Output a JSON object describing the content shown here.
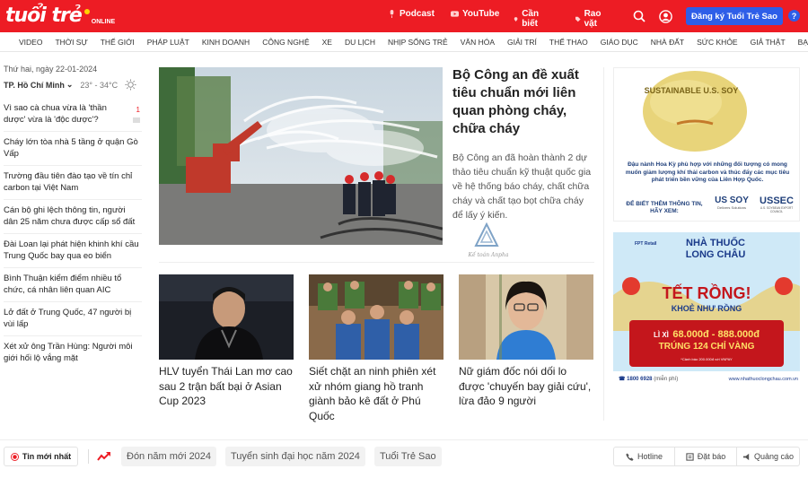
{
  "header": {
    "logo_text": "tuổi trẻ",
    "logo_sub": "ONLINE",
    "links": [
      {
        "label": "Podcast",
        "icon": "mic-icon"
      },
      {
        "label": "YouTube",
        "icon": "youtube-icon"
      },
      {
        "label": "Cần biết",
        "icon": "pin-icon"
      },
      {
        "label": "Rao vặt",
        "icon": "tag-icon"
      }
    ],
    "signup_label": "Đăng ký Tuổi Trẻ Sao",
    "help_label": "?",
    "accent_color": "#ed1c24",
    "button_color": "#2e5ee8"
  },
  "nav": {
    "items": [
      "VIDEO",
      "THỜI SỰ",
      "THẾ GIỚI",
      "PHÁP LUẬT",
      "KINH DOANH",
      "CÔNG NGHỆ",
      "XE",
      "DU LỊCH",
      "NHỊP SỐNG TRẺ",
      "VĂN HÓA",
      "GIẢI TRÍ",
      "THỂ THAO",
      "GIÁO DỤC",
      "NHÀ ĐẤT",
      "SỨC KHỎE",
      "GIẢ THẬT",
      "BẠN ĐỌC"
    ]
  },
  "sidebar": {
    "date": "Thứ hai, ngày 22-01-2024",
    "city": "TP. Hồ Chí Minh",
    "temperature": "23° - 34°C",
    "news": [
      {
        "title": "Vì sao cà chua vừa là 'thần dược' vừa là 'độc dược'?",
        "badge": "1"
      },
      {
        "title": "Cháy lớn tòa nhà 5 tầng ở quận Gò Vấp"
      },
      {
        "title": "Trường đầu tiên đào tạo về tín chỉ carbon tại Việt Nam"
      },
      {
        "title": "Cán bộ ghi lệch thông tin, người dân 25 năm chưa được cấp sổ đất"
      },
      {
        "title": "Đài Loan lại phát hiện khinh khí cầu Trung Quốc bay qua eo biển"
      },
      {
        "title": "Bình Thuận kiểm điểm nhiều tổ chức, cá nhân liên quan AIC"
      },
      {
        "title": "Lở đất ở Trung Quốc, 47 người bị vùi lấp"
      },
      {
        "title": "Xét xử ông Trần Hùng: Người môi giới hối lộ vắng mặt"
      }
    ]
  },
  "hero": {
    "title": "Bộ Công an đề xuất tiêu chuẩn mới liên quan phòng cháy, chữa cháy",
    "sapo": "Bộ Công an đã hoàn thành 2 dự thảo tiêu chuẩn kỹ thuật quốc gia về hệ thống báo cháy, chất chữa cháy và chất tạo bọt chữa cháy để lấy ý kiến.",
    "watermark": "Kế toán Anpha"
  },
  "cards": [
    {
      "title": "HLV tuyển Thái Lan mơ cao sau 2 trận bất bại ở Asian Cup 2023"
    },
    {
      "title": "Siết chặt an ninh phiên xét xử nhóm giang hồ tranh giành bảo kê đất ở Phú Quốc"
    },
    {
      "title": "Nữ giám đốc nói dối lo được 'chuyến bay giải cứu', lừa đảo 9 người"
    }
  ],
  "ads": {
    "soy": {
      "badge": "SUSTAINABLE U.S. SOY",
      "text": "Đậu nành Hoa Kỳ phù hợp với những đối tượng có mong muốn giảm lượng khí thải carbon và thúc đẩy các mục tiêu phát triển bền vững của Liên Hợp Quốc.",
      "cta": "ĐỂ BIẾT THÊM THÔNG TIN, HÃY XEM:",
      "brand1": "US SOY",
      "brand1_sub": "Delivers Solutions",
      "brand2": "USSEC",
      "brand2_sub": "U.S. SOYBEAN EXPORT COUNCIL"
    },
    "pharmacy": {
      "brand_small": "FPT Retail",
      "brand": "NHÀ THUỐC LONG CHÂU",
      "headline": "TẾT RỒNG!",
      "subhead": "KHOẺ NHƯ RỒNG",
      "prize_prefix": "LÌ XÌ",
      "prize_amount": "68.000đ - 888.000đ",
      "prize_line": "TRÚNG 124 CHỈ VÀNG",
      "note": "*Cảnh báo 200.000đ với VNPAY",
      "hotline": "1800 6928",
      "hotline_note": "(miễn phí)",
      "website": "www.nhathuoclongchau.com.vn"
    }
  },
  "bottombar": {
    "hot_label": "Tin mới nhất",
    "tags": [
      "Đón năm mới 2024",
      "Tuyển sinh đại học năm 2024",
      "Tuổi Trẻ Sao"
    ],
    "right_buttons": [
      {
        "label": "Hotline",
        "icon": "phone-icon"
      },
      {
        "label": "Đặt báo",
        "icon": "newspaper-icon"
      },
      {
        "label": "Quảng cáo",
        "icon": "megaphone-icon"
      }
    ]
  }
}
